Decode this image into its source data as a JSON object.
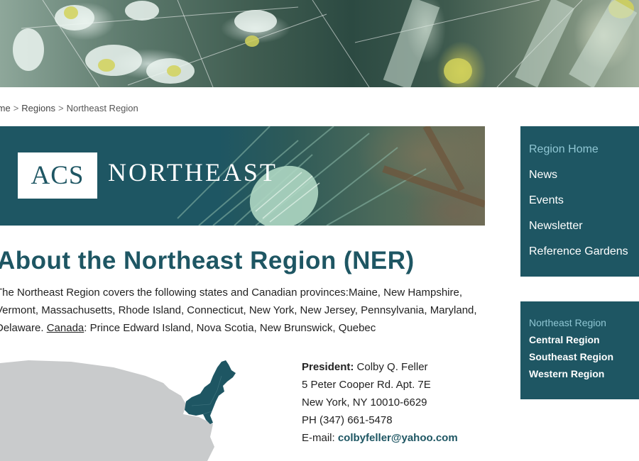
{
  "breadcrumb": {
    "home": "Home",
    "separator": ">",
    "regions": "Regions",
    "current": "Northeast Region"
  },
  "banner": {
    "logo_text": "ACS",
    "heading": "NORTHEAST"
  },
  "main": {
    "title": "About the Northeast Region (NER)",
    "intro_text": "The Northeast Region covers the following states and Canadian provinces:Maine, New Hampshire, Vermont, Massachusetts, Rhode Island, Connecticut, New York, New Jersey, Pennsylvania, Maryland, Delaware. ",
    "canada_label": "Canada",
    "canada_text": ": Prince Edward Island, Nova Scotia, New Brunswick, Quebec"
  },
  "contact": {
    "president_label": "President:",
    "president_name": " Colby Q. Feller",
    "address_line1": "5 Peter Cooper Rd. Apt. 7E",
    "address_line2": "New York, NY 10010-6629",
    "phone": "PH (347) 661-5478",
    "email_label": "E-mail: ",
    "email": "colbyfeller@yahoo.com"
  },
  "sidebar": {
    "nav": [
      {
        "label": "Region Home"
      },
      {
        "label": "News"
      },
      {
        "label": "Events"
      },
      {
        "label": "Newsletter"
      },
      {
        "label": "Reference Gardens"
      }
    ],
    "regions": [
      {
        "label": "Northeast Region"
      },
      {
        "label": "Central Region"
      },
      {
        "label": "Southeast Region"
      },
      {
        "label": "Western Region"
      }
    ]
  },
  "colors": {
    "brand": "#1e5663",
    "active_link": "#8fc6d3",
    "map_gray": "#c9cbcc"
  }
}
